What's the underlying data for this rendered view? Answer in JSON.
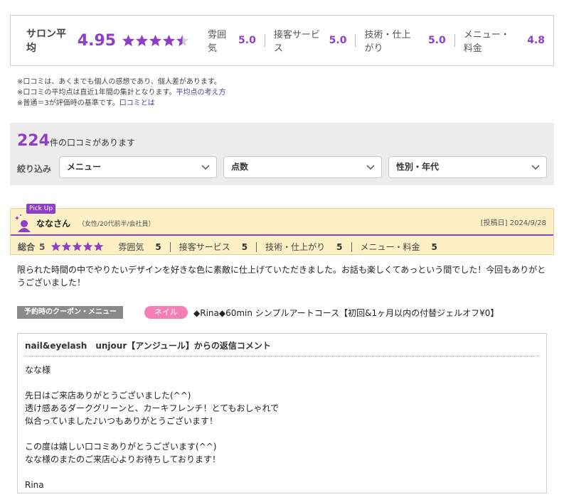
{
  "summary": {
    "label": "サロン平均",
    "score": "4.95",
    "star_fill": [
      1,
      1,
      1,
      1,
      0.5
    ],
    "categories": [
      {
        "label": "雰囲気",
        "value": "5.0"
      },
      {
        "label": "接客サービス",
        "value": "5.0"
      },
      {
        "label": "技術・仕上がり",
        "value": "5.0"
      },
      {
        "label": "メニュー・料金",
        "value": "4.8"
      }
    ]
  },
  "notes": {
    "line1": "※口コミは、あくまでも個人の感想であり、個人差があります。",
    "line2": "※口コミの平均点は直近1年間の集計となります。",
    "line2_link": "平均点の考え方",
    "line3": "※普通＝3が評価時の基準です。",
    "line3_link": "口コミとは"
  },
  "filter": {
    "count": "224",
    "count_suffix": "件の口コミがあります",
    "narrow_label": "絞り込み",
    "menu_select": "メニュー",
    "score_select": "点数",
    "gender_age_select": "性別・年代"
  },
  "review": {
    "pickup": "Pick Up",
    "nickname": "ななさん",
    "profile": "（女性/20代前半/会社員）",
    "posted": "[投稿日] 2024/9/28",
    "total_label": "総合",
    "total_value": "5",
    "total_stars": 5,
    "categories": [
      {
        "label": "雰囲気",
        "value": "5"
      },
      {
        "label": "接客サービス",
        "value": "5"
      },
      {
        "label": "技術・仕上がり",
        "value": "5"
      },
      {
        "label": "メニュー・料金",
        "value": "5"
      }
    ],
    "body": "限られた時間の中でやりたいデザインを好きな色に素敵に仕上げていただきました。お話も楽しくてあっという間でした！今回もありがとうございました！",
    "coupon_label": "予約時のクーポン・メニュー",
    "coupon_tag": "ネイル",
    "coupon_text": "◆Rina◆60min シンプルアートコース【初回&1ヶ月以内の付替ジェルオフ¥0】"
  },
  "reply": {
    "title": "nail&eyelash　unjour【アンジュール】からの返信コメント",
    "line1": "なな様",
    "line2": "先日はご来店ありがとうございました(^^)",
    "line3": "透け感あるダークグリーンと、カーキフレンチ！とてもおしゃれで",
    "line4": "似合っていました♪いつもありがとうございます！",
    "line5": "この度は嬉しい口コミありがとうございます(^^)",
    "line6": "なな様のまたのご来店心よりお待ちしております！",
    "signature": "Rina"
  },
  "colors": {
    "accent": "#8f3fc6",
    "highlight_bg": "#fdf0c4",
    "coupon_tag": "#f47fb8"
  }
}
